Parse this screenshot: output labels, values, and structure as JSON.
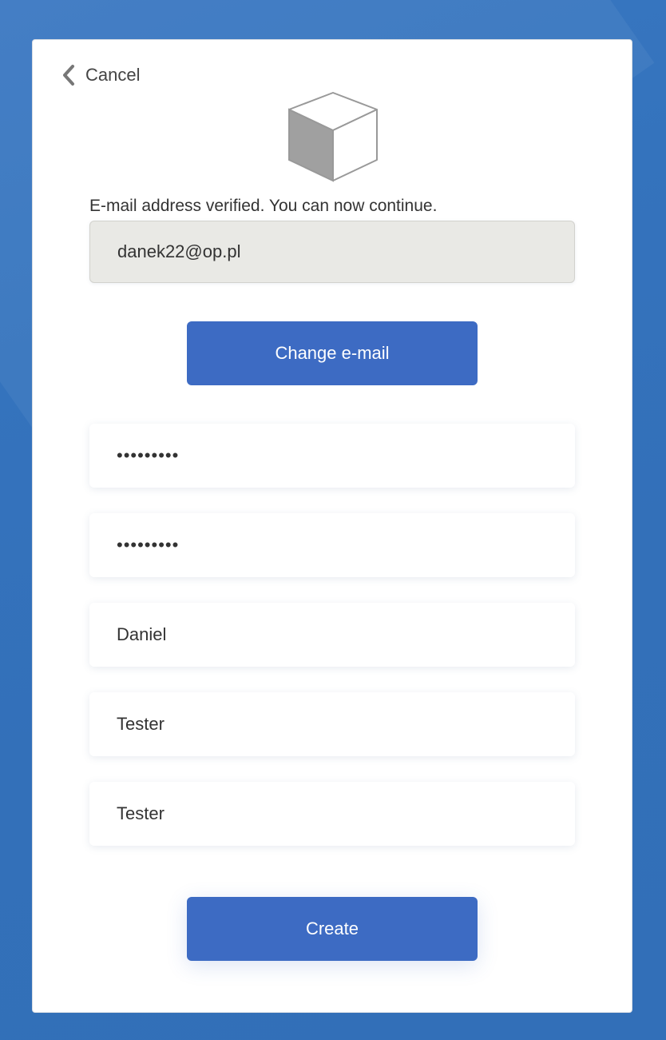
{
  "nav": {
    "cancel_label": "Cancel"
  },
  "logo": {
    "icon": "cube-icon"
  },
  "status": {
    "message": "E-mail address verified. You can now continue."
  },
  "email": {
    "value": "danek22@op.pl"
  },
  "change_email": {
    "label": "Change e-mail"
  },
  "password": {
    "value": "•••••••••"
  },
  "confirm_password": {
    "value": "•••••••••"
  },
  "display_name": {
    "value": "Daniel"
  },
  "given_name": {
    "value": "Tester"
  },
  "surname": {
    "value": "Tester"
  },
  "create": {
    "label": "Create"
  },
  "colors": {
    "background": "#3370b9",
    "accent": "#3d6bc3",
    "readonly_field": "#e9e9e5"
  }
}
